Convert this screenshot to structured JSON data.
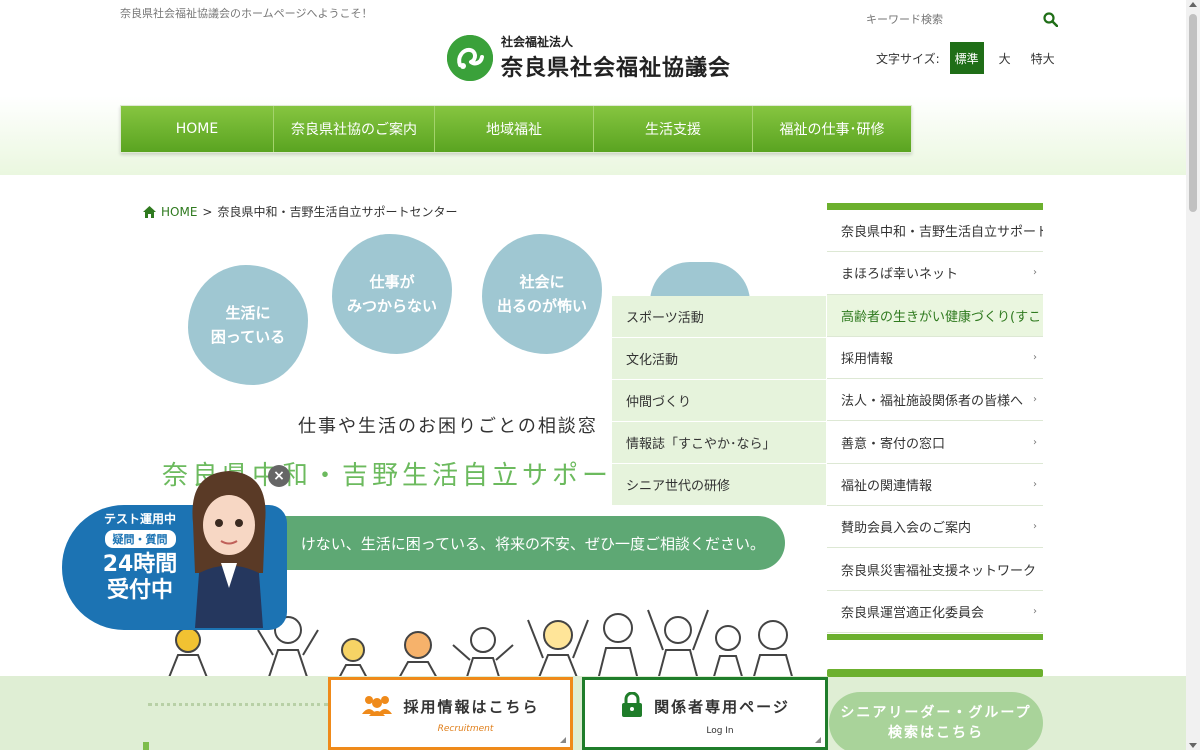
{
  "header": {
    "welcome": "奈良県社会福祉協議会のホームページへようこそ！",
    "logo_sub": "社会福祉法人",
    "logo_main": "奈良県社会福祉協議会",
    "search_placeholder": "キーワード検索",
    "fontsize_label": "文字サイズ:",
    "fontsize_options": [
      "標準",
      "大",
      "特大"
    ]
  },
  "nav": [
    "HOME",
    "奈良県社協のご案内",
    "地域福祉",
    "生活支援",
    "福祉の仕事･研修"
  ],
  "breadcrumb": {
    "home": "HOME",
    "sep": ">",
    "current": "奈良県中和・吉野生活自立サポートセンター"
  },
  "hero": {
    "bubbles": [
      {
        "l1": "生活に",
        "l2": "困っている"
      },
      {
        "l1": "仕事が",
        "l2": "みつからない"
      },
      {
        "l1": "社会に",
        "l2": "出るのが怖い"
      }
    ],
    "tagline": "仕事や生活のお困りごとの相談窓",
    "title": "奈良県中和・吉野生活自立サポー",
    "banner": "けない、生活に困っている、将来の不安、ぜひ一度ご相談ください。"
  },
  "sidebar": [
    "奈良県中和・吉野生活自立サポート",
    "まほろば幸いネット",
    "高齢者の生きがい健康づくり(すこ",
    "採用情報",
    "法人・福祉施設関係者の皆様へ",
    "善意・寄付の窓口",
    "福祉の関連情報",
    "賛助会員入会のご案内",
    "奈良県災害福祉支援ネットワーク",
    "奈良県運営適正化委員会"
  ],
  "submenu": [
    "スポーツ活動",
    "文化活動",
    "仲間づくり",
    "情報誌「すこやか･なら」",
    "シニア世代の研修"
  ],
  "chat": {
    "badge1": "テスト運用中",
    "badge2": "疑問・質問",
    "big1": "24時間",
    "big2": "受付中",
    "close": "×"
  },
  "buttons": {
    "recruit": "採用情報はこちら",
    "recruit_sub": "Recruitment",
    "login": "関係者専用ページ",
    "login_sub": "Log In",
    "senior_l1": "シニアリーダー・グループ",
    "senior_l2": "検索はこちら"
  },
  "colors": {
    "brand_green": "#5aa421",
    "dark_green": "#1f6e17",
    "chat_blue": "#1c73b3",
    "orange": "#ef8a1a"
  },
  "icons": {
    "search": "search-icon",
    "home": "home-icon",
    "people": "people-icon",
    "lock": "lock-icon"
  }
}
